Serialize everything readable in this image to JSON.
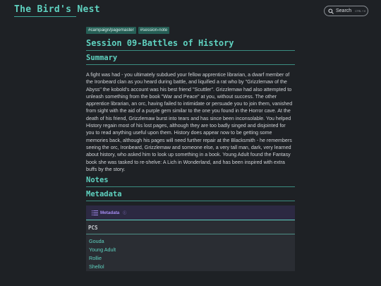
{
  "site": {
    "title": "The Bird's Nest"
  },
  "search": {
    "label": "Search",
    "shortcut": "CTRL + K"
  },
  "tags": [
    "#campaign/pagemaster",
    "#session-note"
  ],
  "page": {
    "title": "Session 09-Battles of History",
    "sections": {
      "summary": "Summary",
      "notes": "Notes",
      "metadata": "Metadata"
    },
    "summary_text": "A fight was had - you ultimately subdued your fellow apprentice librarian, a dwarf member of the Ironbeard clan as you heard during battle, and liquified a rat who by \"Grizzlemaw of the Abyss\" the kobold's account was his best friend \"Scuttler\". Grizzlemaw had also attempted to unleash something from the book \"War and Peace\" at you, without success. The other apprentice librarian, an orc, having failed to intimidate or persuade you to join them, vanished from sight with the aid of a purple gem similar to the one you found in the Horror cave. At the death of his friend, Grizzlemaw burst into tears and has since been inconsolable. You helped History regain most of his lost pages, although they are too badly singed and disjointed for you to read anything useful upon them. History does appear now to be getting some memories back, although his pages will need further repair at the Blacksmith - he remembers seeing the orc, Ironbeard, Grizzlemaw and someone else, a very tall man, dark, very learned about history, who asked him to look up something in a book. Young Adult found the Fantasy book she was tasked to re-shelve: A Lich in Wonderland, and has been inspired with extra buffs by the story."
  },
  "metadata": {
    "title": "Metadata",
    "pcs_label": "PCS",
    "pcs": [
      "Gouda",
      "Young Adult",
      "Rollie",
      "Shellol"
    ]
  },
  "colors": {
    "background": "#1e2125",
    "accent": "#5fd2c0",
    "tag_bg": "#265e55",
    "metadata_header_bg": "#2c2942",
    "metadata_title": "#a58cf2"
  },
  "icons": {
    "search": "search-icon",
    "metadata": "list-icon",
    "info": "info-icon"
  }
}
